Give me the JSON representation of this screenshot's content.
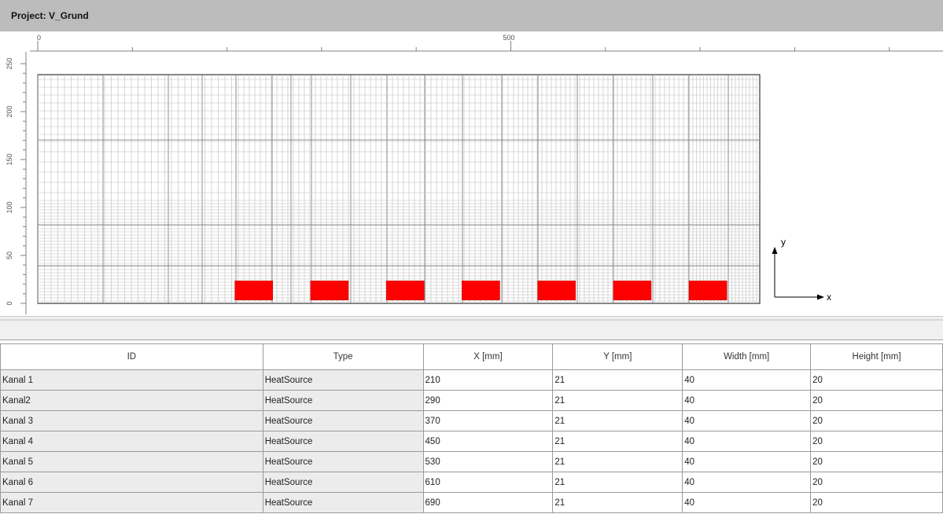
{
  "project": {
    "title": "Project: V_Grund"
  },
  "ruler": {
    "x_labels": [
      {
        "value": 0,
        "label": "0"
      },
      {
        "value": 500,
        "label": "500"
      }
    ],
    "y_labels": [
      {
        "value": 250,
        "label": "250"
      },
      {
        "value": 200,
        "label": "200"
      },
      {
        "value": 150,
        "label": "150"
      },
      {
        "value": 100,
        "label": "100"
      },
      {
        "value": 50,
        "label": "50"
      },
      {
        "value": 0,
        "label": "0"
      }
    ]
  },
  "axis_indicator": {
    "x_label": "x",
    "y_label": "y"
  },
  "heat_source_color": "#ff0000",
  "table": {
    "columns": [
      "ID",
      "Type",
      "X [mm]",
      "Y [mm]",
      "Width [mm]",
      "Height [mm]"
    ],
    "rows": [
      {
        "id": "Kanal 1",
        "type": "HeatSource",
        "x": "210",
        "y": "21",
        "width": "40",
        "height": "20"
      },
      {
        "id": "Kanal2",
        "type": "HeatSource",
        "x": "290",
        "y": "21",
        "width": "40",
        "height": "20"
      },
      {
        "id": "Kanal 3",
        "type": "HeatSource",
        "x": "370",
        "y": "21",
        "width": "40",
        "height": "20"
      },
      {
        "id": "Kanal 4",
        "type": "HeatSource",
        "x": "450",
        "y": "21",
        "width": "40",
        "height": "20"
      },
      {
        "id": "Kanal 5",
        "type": "HeatSource",
        "x": "530",
        "y": "21",
        "width": "40",
        "height": "20"
      },
      {
        "id": "Kanal 6",
        "type": "HeatSource",
        "x": "610",
        "y": "21",
        "width": "40",
        "height": "20"
      },
      {
        "id": "Kanal 7",
        "type": "HeatSource",
        "x": "690",
        "y": "21",
        "width": "40",
        "height": "20"
      }
    ]
  }
}
